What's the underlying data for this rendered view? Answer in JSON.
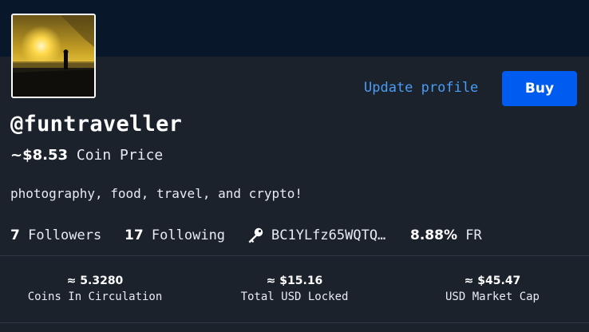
{
  "profile": {
    "username": "@funtraveller",
    "coin_price_value": "~$8.53",
    "coin_price_label": "Coin Price",
    "bio": "photography, food, travel, and crypto!",
    "update_link": "Update profile",
    "buy_label": "Buy"
  },
  "stats": {
    "followers_count": "7",
    "followers_label": "Followers",
    "following_count": "17",
    "following_label": "Following",
    "public_key": "BC1YLfz65WQTQ…",
    "founder_reward": "8.88%",
    "founder_reward_label": "FR"
  },
  "metrics": [
    {
      "value": "≈ 5.3280",
      "label": "Coins In Circulation"
    },
    {
      "value": "≈ $15.16",
      "label": "Total USD Locked"
    },
    {
      "value": "≈ $45.47",
      "label": "USD Market Cap"
    }
  ],
  "colors": {
    "background": "#1b222c",
    "banner": "#09172a",
    "accent_link": "#4a9cf5",
    "buy_button": "#005bf0"
  },
  "icons": {
    "key": "key-icon"
  }
}
